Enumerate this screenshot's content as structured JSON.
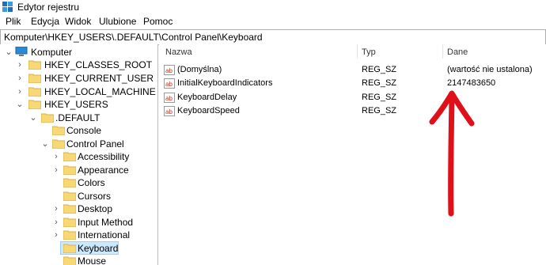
{
  "window": {
    "title": "Edytor rejestru"
  },
  "menu": [
    "Plik",
    "Edycja",
    "Widok",
    "Ulubione",
    "Pomoc"
  ],
  "address": "Komputer\\HKEY_USERS\\.DEFAULT\\Control Panel\\Keyboard",
  "tree": {
    "root": "Komputer",
    "hives": [
      "HKEY_CLASSES_ROOT",
      "HKEY_CURRENT_USER",
      "HKEY_LOCAL_MACHINE",
      "HKEY_USERS"
    ],
    "default": ".DEFAULT",
    "console": "Console",
    "control_panel": "Control Panel",
    "children": [
      "Accessibility",
      "Appearance",
      "Colors",
      "Cursors",
      "Desktop",
      "Input Method",
      "International",
      "Keyboard",
      "Mouse"
    ],
    "selected": "Keyboard"
  },
  "list": {
    "headers": [
      "Nazwa",
      "Typ",
      "Dane"
    ],
    "rows": [
      {
        "name": "(Domyślna)",
        "type": "REG_SZ",
        "data": "(wartość nie ustalona)"
      },
      {
        "name": "InitialKeyboardIndicators",
        "type": "REG_SZ",
        "data": "2147483650"
      },
      {
        "name": "KeyboardDelay",
        "type": "REG_SZ",
        "data": ""
      },
      {
        "name": "KeyboardSpeed",
        "type": "REG_SZ",
        "data": ""
      }
    ]
  },
  "colors": {
    "arrow": "#e0101a",
    "selection": "#cce8ff",
    "folder": "#f8d775"
  }
}
